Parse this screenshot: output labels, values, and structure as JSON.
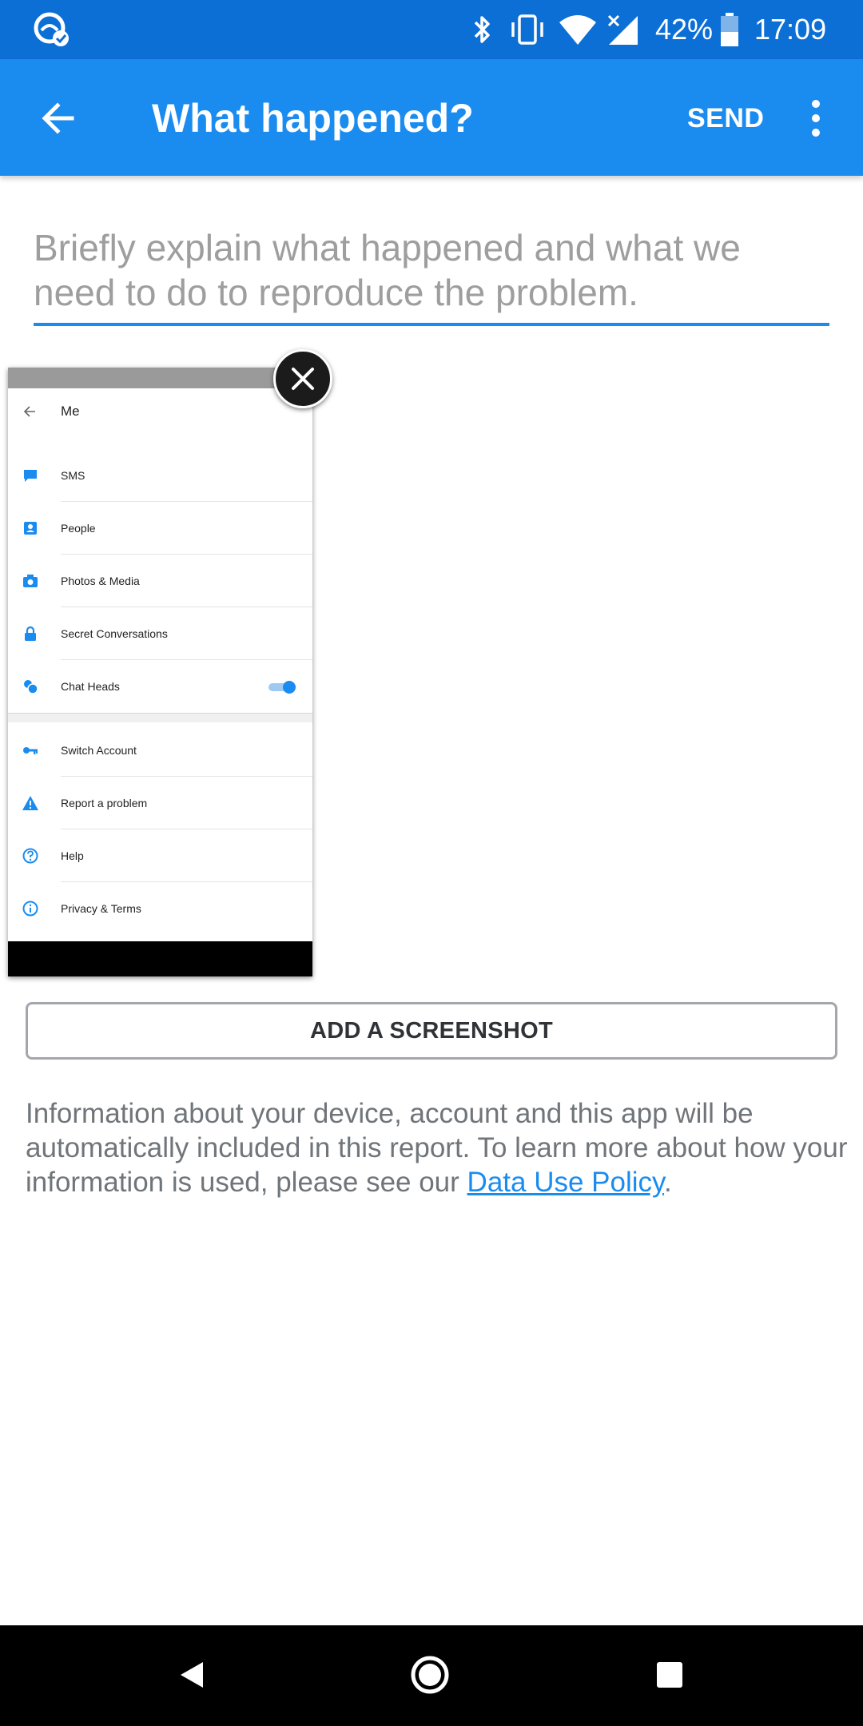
{
  "status_bar": {
    "battery": "42%",
    "time": "17:09",
    "icons": [
      "app-notification-icon",
      "bluetooth-icon",
      "vibrate-icon",
      "wifi-icon",
      "signal-icon",
      "battery-icon"
    ]
  },
  "toolbar": {
    "title": "What happened?",
    "send_label": "SEND",
    "icons": [
      "back-arrow-icon",
      "more-vert-icon"
    ]
  },
  "description": {
    "placeholder": "Briefly explain what happened and what we need to do to reproduce the problem."
  },
  "screenshot_preview": {
    "title": "Me",
    "items": [
      {
        "label": "SMS",
        "icon": "chat-bubble-icon"
      },
      {
        "label": "People",
        "icon": "contact-icon"
      },
      {
        "label": "Photos & Media",
        "icon": "camera-icon"
      },
      {
        "label": "Secret Conversations",
        "icon": "lock-icon"
      },
      {
        "label": "Chat Heads",
        "icon": "chat-heads-icon",
        "toggle_on": true
      },
      {
        "label": "Switch Account",
        "icon": "key-icon"
      },
      {
        "label": "Report a problem",
        "icon": "warning-icon"
      },
      {
        "label": "Help",
        "icon": "help-icon"
      },
      {
        "label": "Privacy & Terms",
        "icon": "info-icon"
      }
    ],
    "remove_icon": "close-icon"
  },
  "add_screenshot_label": "ADD A SCREENSHOT",
  "info": {
    "text": "Information about your device, account and this app will be automatically included in this report. To learn more about how your information is used, please see our ",
    "link": "Data Use Policy",
    "end": "."
  },
  "nav_bar": {
    "icons": [
      "back-triangle-icon",
      "home-circle-icon",
      "recents-square-icon"
    ]
  },
  "colors": {
    "status_bar": "#0c6fd6",
    "toolbar": "#1a8cf0",
    "link": "#1a8cf0"
  }
}
